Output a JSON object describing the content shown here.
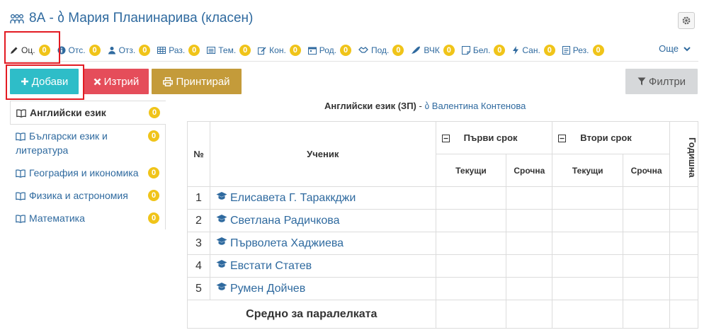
{
  "header": {
    "title": "8А - ბ Мария Планинарива (класен)"
  },
  "tabs": [
    {
      "label": "Оц.",
      "count": "0"
    },
    {
      "label": "Отс.",
      "count": "0"
    },
    {
      "label": "Отз.",
      "count": "0"
    },
    {
      "label": "Раз.",
      "count": "0"
    },
    {
      "label": "Тем.",
      "count": "0"
    },
    {
      "label": "Кон.",
      "count": "0"
    },
    {
      "label": "Род.",
      "count": "0"
    },
    {
      "label": "Под.",
      "count": "0"
    },
    {
      "label": "ВЧК",
      "count": "0"
    },
    {
      "label": "Бел.",
      "count": "0"
    },
    {
      "label": "Сан.",
      "count": "0"
    },
    {
      "label": "Рез.",
      "count": "0"
    }
  ],
  "tabs_more": "Още",
  "toolbar": {
    "add": "Добави",
    "delete": "Изтрий",
    "print": "Принтирай",
    "filter": "Филтри"
  },
  "subjects": [
    {
      "label": "Английски език",
      "count": "0"
    },
    {
      "label": "Български език и литература",
      "count": "0"
    },
    {
      "label": "География и икономика",
      "count": "0"
    },
    {
      "label": "Физика и астрономия",
      "count": "0"
    },
    {
      "label": "Математика",
      "count": "0"
    }
  ],
  "caption": {
    "subject": "Английски език (ЗП)",
    "separator": " - ",
    "teacher": "ბ Валентина Контенова"
  },
  "table": {
    "col_num": "№",
    "col_student": "Ученик",
    "term1": "Първи срок",
    "term2": "Втори срок",
    "current": "Текущи",
    "final": "Срочна",
    "annual": "Годишна",
    "students": [
      {
        "num": "1",
        "name": "Елисавета Г. Тараккджи"
      },
      {
        "num": "2",
        "name": "Светлана Радичкова"
      },
      {
        "num": "3",
        "name": "Първолета Хаджиева"
      },
      {
        "num": "4",
        "name": "Евстати Статев"
      },
      {
        "num": "5",
        "name": "Румен Дойчев"
      }
    ],
    "average": "Средно за паралелката"
  },
  "colors": {
    "link": "#2f6a9f",
    "badge": "#f0c419",
    "add": "#2ebdc8",
    "delete": "#e54d5a",
    "print": "#c49b3a",
    "highlight": "#e31b23"
  }
}
